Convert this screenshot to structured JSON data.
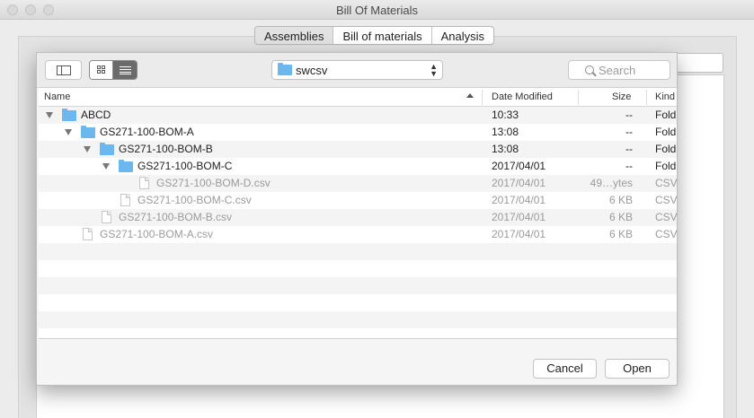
{
  "window": {
    "title": "Bill Of Materials"
  },
  "tabs": [
    "Assemblies",
    "Bill of materials",
    "Analysis"
  ],
  "dialog": {
    "location": "swcsv",
    "search_placeholder": "Search",
    "columns": {
      "name": "Name",
      "date": "Date Modified",
      "size": "Size",
      "kind": "Kind"
    },
    "rows": [
      {
        "name": "ABCD",
        "date": "10:33",
        "size": "--",
        "kind": "Fold"
      },
      {
        "name": "GS271-100-BOM-A",
        "date": "13:08",
        "size": "--",
        "kind": "Fold"
      },
      {
        "name": "GS271-100-BOM-B",
        "date": "13:08",
        "size": "--",
        "kind": "Fold"
      },
      {
        "name": "GS271-100-BOM-C",
        "date": "2017/04/01",
        "size": "--",
        "kind": "Fold"
      },
      {
        "name": "GS271-100-BOM-D.csv",
        "date": "2017/04/01",
        "size": "49…ytes",
        "kind": "CSV"
      },
      {
        "name": "GS271-100-BOM-C.csv",
        "date": "2017/04/01",
        "size": "6 KB",
        "kind": "CSV"
      },
      {
        "name": "GS271-100-BOM-B.csv",
        "date": "2017/04/01",
        "size": "6 KB",
        "kind": "CSV"
      },
      {
        "name": "GS271-100-BOM-A.csv",
        "date": "2017/04/01",
        "size": "6 KB",
        "kind": "CSV"
      }
    ],
    "cancel_label": "Cancel",
    "open_label": "Open"
  },
  "colors": {
    "folder": "#6cb8ee",
    "list_view_selected": "#6b6b6b"
  }
}
